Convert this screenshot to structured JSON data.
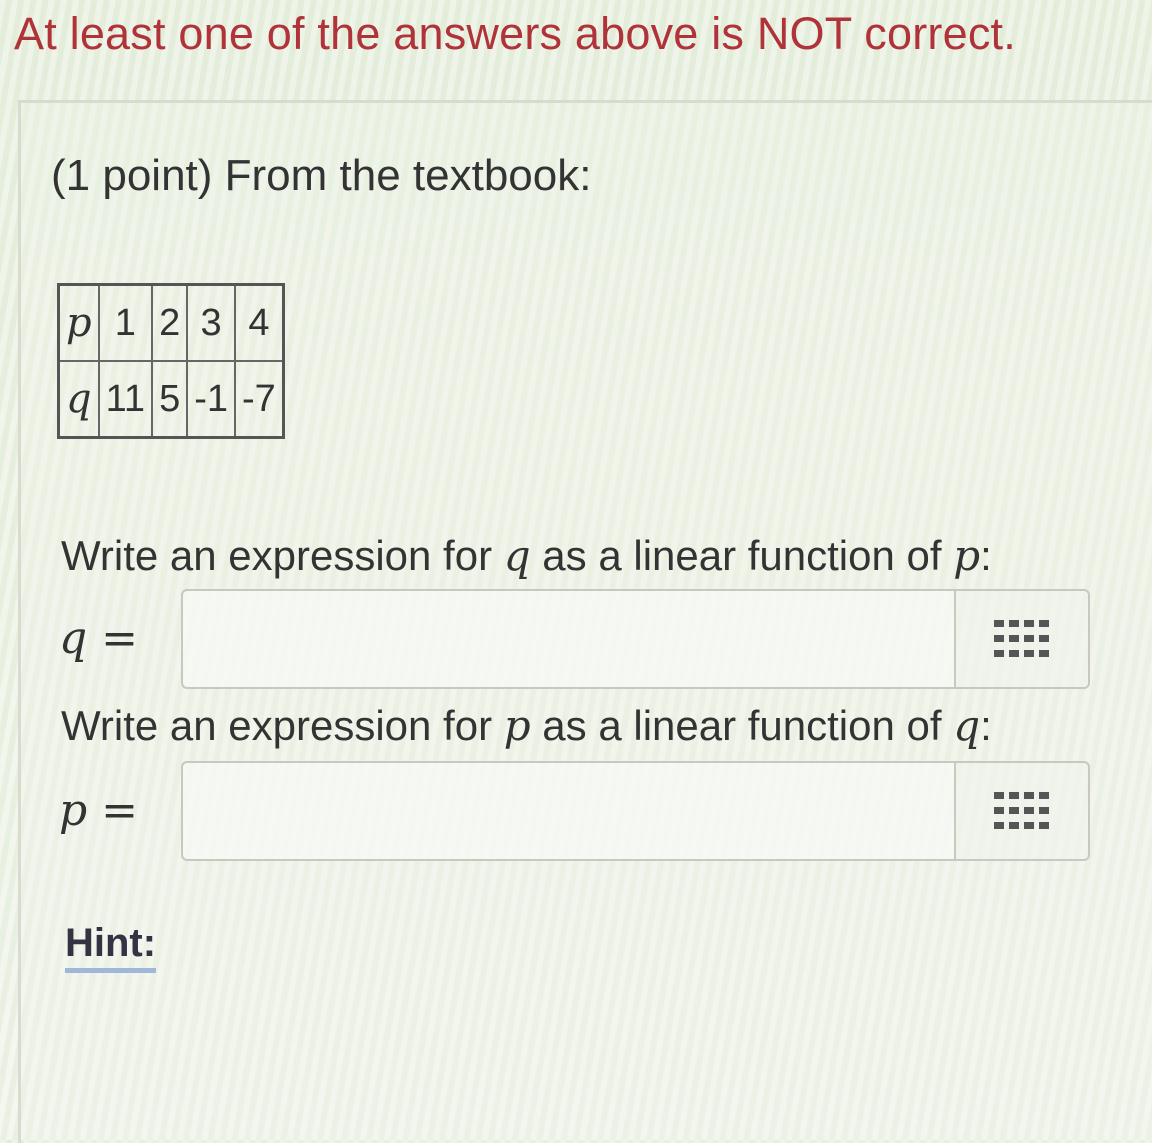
{
  "banner": "At least one of the answers above is NOT correct.",
  "problem": {
    "intro": "(1 point) From the textbook:",
    "table": {
      "rows": [
        {
          "var": "p",
          "cells": [
            "1",
            "2",
            "3",
            "4"
          ]
        },
        {
          "var": "q",
          "cells": [
            "11",
            "5",
            "-1",
            "-7"
          ]
        }
      ]
    },
    "question1": {
      "prefix": "Write an expression for ",
      "var1": "q",
      "middle": " as a linear function of ",
      "var2": "p",
      "suffix": ":",
      "lhs": "q =",
      "value": ""
    },
    "question2": {
      "prefix": "Write an expression for ",
      "var1": "p",
      "middle": " as a linear function of ",
      "var2": "q",
      "suffix": ":",
      "lhs": "p =",
      "value": ""
    },
    "hint_label": "Hint:"
  },
  "colors": {
    "banner": "#b0333a",
    "hint_underline": "#9fb7d8"
  },
  "icons": {
    "keyboard": "keypad-icon"
  }
}
